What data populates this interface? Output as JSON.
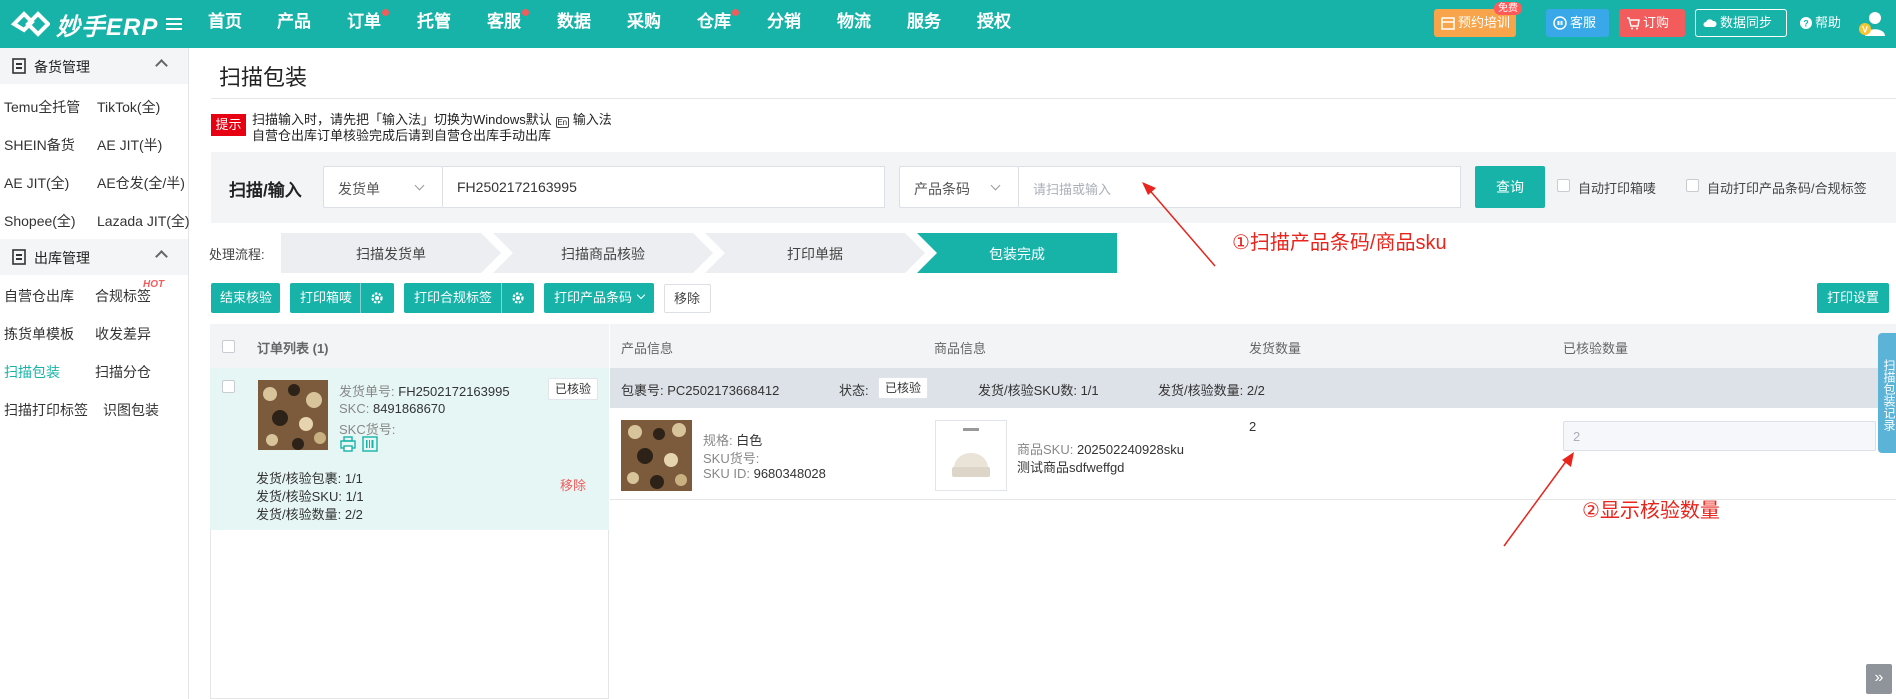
{
  "app": {
    "logo_text": "妙手ERP",
    "nav": [
      "首页",
      "产品",
      "订单",
      "托管",
      "客服",
      "数据",
      "采购",
      "仓库",
      "分销",
      "物流",
      "服务",
      "授权"
    ],
    "top_buttons": {
      "training": "预约培训",
      "free_badge": "免费",
      "service": "客服",
      "order": "订购",
      "sync": "数据同步",
      "help": "帮助"
    },
    "accent_color": "#17b3a8"
  },
  "sidebar": {
    "group1": "备货管理",
    "group1_items": [
      "Temu全托管",
      "TikTok(全)",
      "SHEIN备货",
      "AE JIT(半)",
      "AE JIT(全)",
      "AE仓发(全/半)",
      "Shopee(全)",
      "Lazada JIT(全)"
    ],
    "group2": "出库管理",
    "group2_items": [
      "自营仓出库",
      "合规标签",
      "拣货单模板",
      "收发差异",
      "扫描包装",
      "扫描分仓",
      "扫描打印标签",
      "识图包装"
    ],
    "hot": "HOT"
  },
  "page": {
    "title": "扫描包装",
    "tip_badge": "提示",
    "tip_line1a": "扫描输入时，请先把「输入法」切换为Windows默认",
    "tip_line1b": "输入法",
    "kbd": "En",
    "tip_line2": "自营仓出库订单核验完成后请到自营仓出库手动出库"
  },
  "scan": {
    "label": "扫描/输入",
    "type_select": "发货单",
    "order_value": "FH2502172163995",
    "barcode_select": "产品条码",
    "barcode_placeholder": "请扫描或输入",
    "query": "查询",
    "auto_print_box": "自动打印箱唛",
    "auto_print_label": "自动打印产品条码/合规标签"
  },
  "flow": {
    "label": "处理流程:",
    "steps": [
      "扫描发货单",
      "扫描商品核验",
      "打印单据",
      "包装完成"
    ]
  },
  "actions": {
    "finish": "结束核验",
    "print_box": "打印箱唛",
    "print_compliance": "打印合规标签",
    "print_barcode": "打印产品条码",
    "remove": "移除",
    "print_settings": "打印设置"
  },
  "table": {
    "order_list": "订单列表 (1)",
    "cols": [
      "产品信息",
      "商品信息",
      "发货数量",
      "已核验数量"
    ]
  },
  "order": {
    "ship_no_label": "发货单号:",
    "ship_no": "FH2502172163995",
    "skc_label": "SKC:",
    "skc": "8491868670",
    "skc_code_label": "SKC货号:",
    "status": "已核验",
    "pkg_stat": "发货/核验包裹: 1/1",
    "sku_stat": "发货/核验SKU: 1/1",
    "qty_stat": "发货/核验数量: 2/2",
    "remove": "移除"
  },
  "package": {
    "no_label": "包裹号:",
    "no": "PC2502173668412",
    "state_label": "状态:",
    "state": "已核验",
    "sku_count": "发货/核验SKU数: 1/1",
    "qty_count": "发货/核验数量: 2/2"
  },
  "product": {
    "spec_label": "规格:",
    "spec": "白色",
    "sku_code_label": "SKU货号:",
    "sku_id_label": "SKU ID:",
    "sku_id": "9680348028",
    "goods_sku_label": "商品SKU:",
    "goods_sku": "202502240928sku",
    "goods_name": "测试商品sdfweffgd",
    "ship_qty": "2",
    "verified_qty_placeholder": "2"
  },
  "annotations": {
    "a1": "①扫描产品条码/商品sku",
    "a2": "②显示核验数量"
  },
  "side_tab": "扫描包装记录"
}
